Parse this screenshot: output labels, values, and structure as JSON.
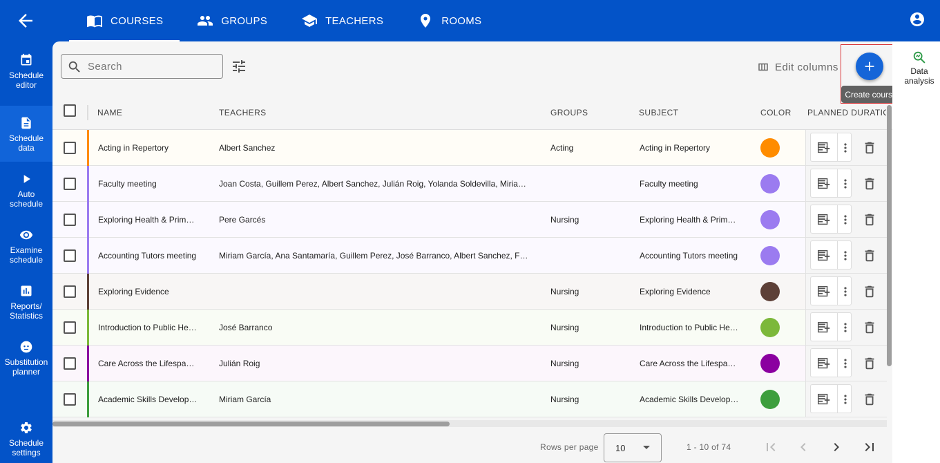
{
  "topbar": {
    "tabs": [
      {
        "label": "COURSES",
        "icon": "book-open-icon",
        "active": true
      },
      {
        "label": "GROUPS",
        "icon": "people-icon"
      },
      {
        "label": "TEACHERS",
        "icon": "school-icon"
      },
      {
        "label": "ROOMS",
        "icon": "location-pin-icon"
      }
    ]
  },
  "sidebar": {
    "items": [
      {
        "label": "Schedule editor",
        "icon": "calendar-icon"
      },
      {
        "label": "Schedule data",
        "icon": "document-icon",
        "active": true
      },
      {
        "label": "Auto schedule",
        "icon": "play-icon"
      },
      {
        "label": "Examine schedule",
        "icon": "eye-icon"
      },
      {
        "label": "Reports/ Statistics",
        "icon": "bar-chart-icon"
      },
      {
        "label": "Substitution planner",
        "icon": "face-icon"
      },
      {
        "label": "Schedule settings",
        "icon": "gear-icon"
      }
    ]
  },
  "toolbar": {
    "search_placeholder": "Search",
    "edit_columns_label": "Edit columns",
    "create_tooltip": "Create course"
  },
  "right_panel": {
    "data_analysis_label": "Data analysis"
  },
  "table": {
    "columns": [
      "NAME",
      "TEACHERS",
      "GROUPS",
      "SUBJECT",
      "COLOR",
      "PLANNED DURATIO"
    ],
    "rows": [
      {
        "name": "Acting in Repertory",
        "teachers": "Albert Sanchez",
        "groups": "Acting",
        "subject": "Acting in Repertory",
        "color": "#ff8c00",
        "stripe": "#ff8c00",
        "bg": "#fffdf7"
      },
      {
        "name": "Faculty meeting",
        "teachers": "Joan Costa, Guillem Perez, Albert Sanchez, Julián Roig, Yolanda Soldevilla, Miria…",
        "groups": "",
        "subject": "Faculty meeting",
        "color": "#9b7bf0",
        "stripe": "#9b7bf0",
        "bg": "#fbf9ff"
      },
      {
        "name": "Exploring Health & Prim…",
        "teachers": "Pere Garcés",
        "groups": "Nursing",
        "subject": "Exploring Health & Prim…",
        "color": "#9b7bf0",
        "stripe": "#9b7bf0",
        "bg": "#fbf9ff"
      },
      {
        "name": "Accounting Tutors meeting",
        "teachers": "Miriam García, Ana Santamaría, Guillem Perez, José Barranco, Albert Sanchez, F…",
        "groups": "",
        "subject": "Accounting Tutors meeting",
        "color": "#9b7bf0",
        "stripe": "#9b7bf0",
        "bg": "#fbf9ff"
      },
      {
        "name": "Exploring Evidence",
        "teachers": "",
        "groups": "Nursing",
        "subject": "Exploring Evidence",
        "color": "#5d4037",
        "stripe": "#5d4037",
        "bg": "#f8f6f5"
      },
      {
        "name": "Introduction to Public He…",
        "teachers": "José Barranco",
        "groups": "Nursing",
        "subject": "Introduction to Public He…",
        "color": "#7cb83a",
        "stripe": "#7cb83a",
        "bg": "#f9fcf5"
      },
      {
        "name": "Care Across the Lifespa…",
        "teachers": "Julián Roig",
        "groups": "Nursing",
        "subject": "Care Across the Lifespa…",
        "color": "#8b00a0",
        "stripe": "#8b00a0",
        "bg": "#fcf6fc"
      },
      {
        "name": "Academic Skills Develop…",
        "teachers": "Miriam García",
        "groups": "Nursing",
        "subject": "Academic Skills Develop…",
        "color": "#3d9e3d",
        "stripe": "#3d9e3d",
        "bg": "#f6fbf6"
      }
    ]
  },
  "pagination": {
    "rows_per_page_label": "Rows per page",
    "rows_per_page_value": "10",
    "range_label": "1 - 10 of 74"
  }
}
